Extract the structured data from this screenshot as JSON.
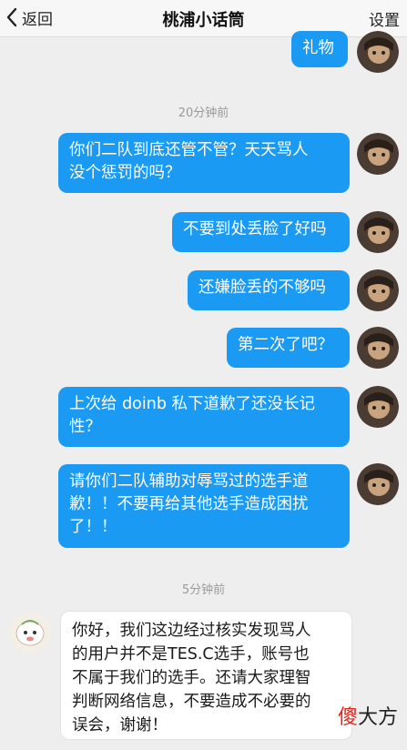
{
  "header": {
    "back_label": "返回",
    "title": "桃浦小话筒",
    "settings_label": "设置"
  },
  "times": {
    "t1": "20分钟前",
    "t2": "5分钟前"
  },
  "messages": {
    "m0": "礼物",
    "m1": [
      "你们二队到底还管不管？天天骂人",
      "没个惩罚的吗？"
    ],
    "m2": "不要到处丢脸了好吗",
    "m3": "还嫌脸丢的不够吗",
    "m4": "第二次了吧？",
    "m5": [
      "上次给 doinb 私下道歉了还没长记",
      "性？"
    ],
    "m6": [
      "请你们二队辅助对辱骂过的选手道",
      "歉！！不要再给其他选手造成困扰",
      "了！！"
    ],
    "reply": [
      "你好，我们这边经过核实发现骂人",
      "的用户并不是TES.C选手，账号也",
      "不属于我们的选手。还请大家理智",
      "判断网络信息，不要造成不必要的",
      "误会，谢谢！"
    ]
  },
  "watermark": {
    "part1": "傻",
    "part2": "大方"
  },
  "colors": {
    "outgoing_bubble": "#1a9af3",
    "incoming_bubble": "#ffffff",
    "background": "#eeeeee"
  }
}
